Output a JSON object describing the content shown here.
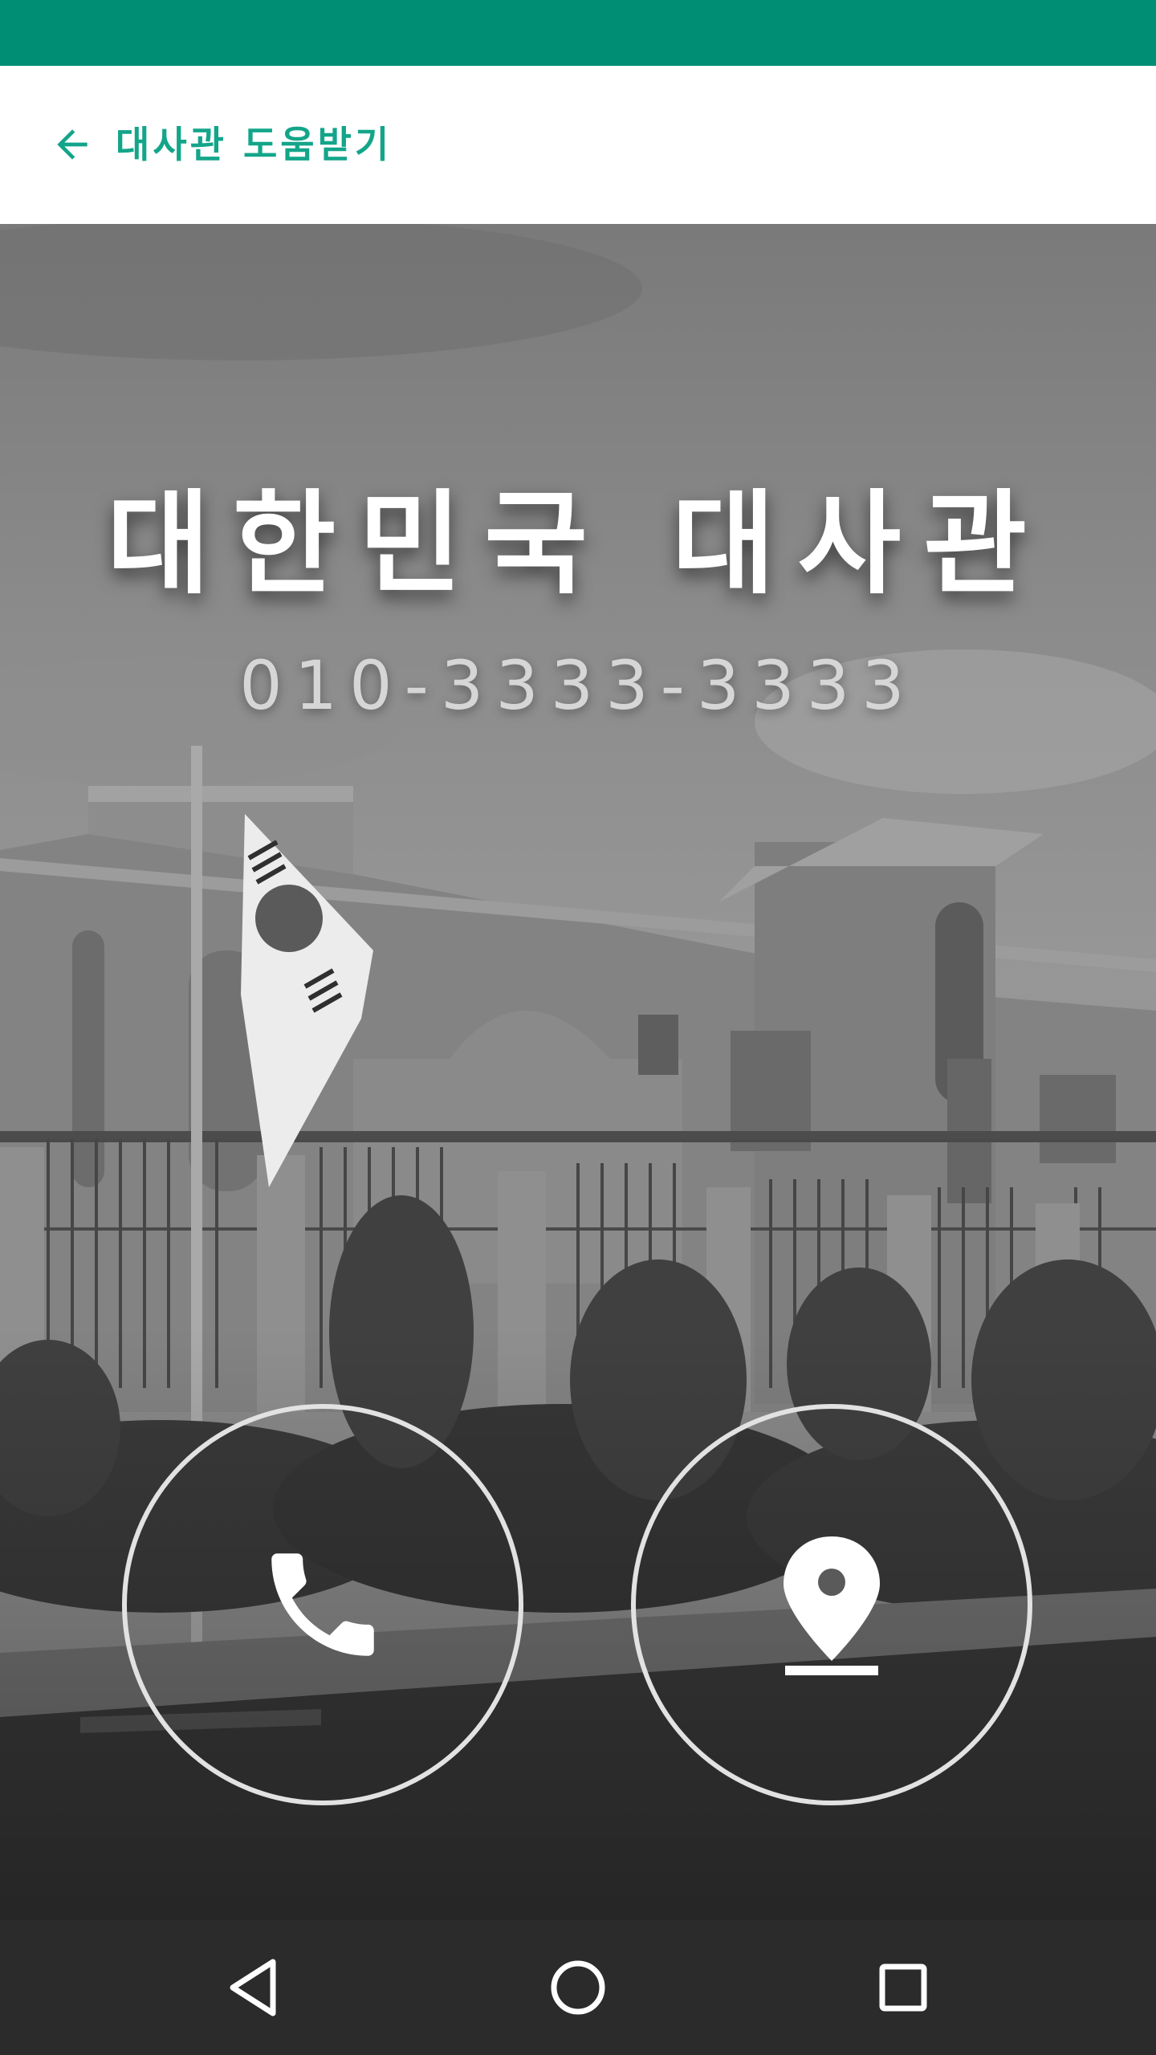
{
  "app_bar": {
    "title": "대사관 도움받기",
    "back_icon": "arrow-back-icon",
    "accent_color": "#13a58a"
  },
  "status_bar": {
    "color": "#008e74"
  },
  "embassy": {
    "name": "대한민국 대사관",
    "phone": "010-3333-3333"
  },
  "actions": {
    "call_icon": "phone-icon",
    "map_icon": "location-pin-icon"
  },
  "navigation": {
    "back_icon": "nav-back-triangle-icon",
    "home_icon": "nav-home-circle-icon",
    "recent_icon": "nav-recent-square-icon"
  }
}
